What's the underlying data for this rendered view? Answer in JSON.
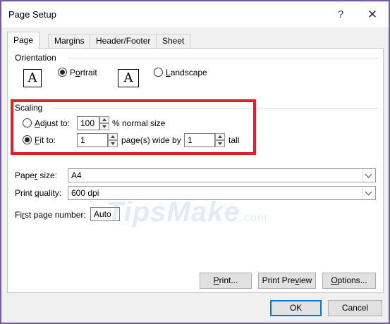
{
  "window": {
    "title": "Page Setup",
    "help_label": "?",
    "close_label": "✕"
  },
  "tabs": [
    {
      "label": "Page",
      "active": true
    },
    {
      "label": "Margins",
      "active": false
    },
    {
      "label": "Header/Footer",
      "active": false
    },
    {
      "label": "Sheet",
      "active": false
    }
  ],
  "orientation": {
    "group_label": "Orientation",
    "icon_glyph": "A",
    "portrait": {
      "pre": "P",
      "ul": "o",
      "post": "rtrait",
      "selected": true
    },
    "landscape": {
      "pre": "",
      "ul": "L",
      "post": "andscape",
      "selected": false
    }
  },
  "scaling": {
    "group_label": "Scaling",
    "adjust": {
      "pre": "",
      "ul": "A",
      "post": "djust to:",
      "value": "100",
      "suffix": "% normal size",
      "selected": false
    },
    "fit": {
      "pre": "",
      "ul": "F",
      "post": "it to:",
      "wide_value": "1",
      "wide_suffix": "page(s) wide by",
      "tall_value": "1",
      "tall_suffix": "tall",
      "selected": true
    }
  },
  "paper_size": {
    "pre": "Pape",
    "ul": "r",
    "post": " size:",
    "value": "A4"
  },
  "print_quality": {
    "pre": "Print ",
    "ul": "q",
    "post": "uality:",
    "value": "600 dpi"
  },
  "first_page": {
    "pre": "Fi",
    "ul": "r",
    "post": "st page number:",
    "value": "Auto"
  },
  "buttons": {
    "print": {
      "pre": "",
      "ul": "P",
      "post": "rint..."
    },
    "print_preview": {
      "pre": "Print Pre",
      "ul": "v",
      "post": "iew"
    },
    "options": {
      "pre": "",
      "ul": "O",
      "post": "ptions..."
    },
    "ok": "OK",
    "cancel": "Cancel"
  },
  "watermark": {
    "main": "TipsMake",
    "suffix": ".com"
  },
  "colors": {
    "highlight": "#e0202a",
    "accent": "#0078d7",
    "frame": "#7b5ba8"
  }
}
